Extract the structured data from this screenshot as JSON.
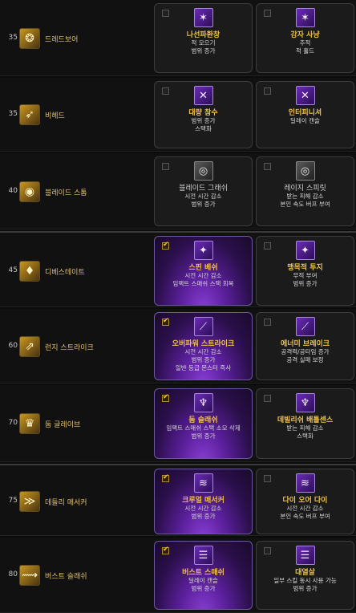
{
  "rows": [
    {
      "level": "35",
      "skill": "드레드보어",
      "left": {
        "title": "나선파환창",
        "lines": [
          "적 모으기",
          "범위 증가"
        ],
        "checked": false,
        "selected": false
      },
      "right": {
        "title": "강자 사냥",
        "lines": [
          "추적",
          "적 홀드"
        ],
        "checked": false,
        "selected": false
      }
    },
    {
      "level": "35",
      "skill": "비헤드",
      "left": {
        "title": "대량 참수",
        "lines": [
          "범위 증가",
          "스택화"
        ],
        "checked": false,
        "selected": false
      },
      "right": {
        "title": "인터피니셔",
        "lines": [
          "딜레이 캔슬"
        ],
        "checked": false,
        "selected": false
      }
    },
    {
      "level": "40",
      "skill": "블레이드 스톰",
      "left": {
        "title": "블레이드 그래쉬",
        "lines": [
          "시전 시간 감소",
          "범위 증가"
        ],
        "checked": false,
        "selected": false
      },
      "right": {
        "title": "레이지 스피릿",
        "lines": [
          "받는 피해 감소",
          "본인 속도 버프 부여"
        ],
        "checked": false,
        "selected": false
      }
    },
    {
      "level": "45",
      "skill": "디베스테이트",
      "left": {
        "title": "스핀 베쉬",
        "lines": [
          "시전 시간 감소",
          "임팩트 스매쉬 스택 회복"
        ],
        "checked": true,
        "selected": true
      },
      "right": {
        "title": "맹목적 투지",
        "lines": [
          "무적 부여",
          "범위 증가"
        ],
        "checked": false,
        "selected": false
      }
    },
    {
      "level": "60",
      "skill": "런지 스트라이크",
      "left": {
        "title": "오버파워 스트라이크",
        "lines": [
          "시전 시간 감소",
          "범위 증가",
          "일반 등급 몬스터 즉사"
        ],
        "checked": true,
        "selected": true
      },
      "right": {
        "title": "에너미 브레이크",
        "lines": [
          "공격력/공타임 증가",
          "공격 실패 보정"
        ],
        "checked": false,
        "selected": false
      }
    },
    {
      "level": "70",
      "skill": "둠 글레이브",
      "left": {
        "title": "둠 슬래쉬",
        "lines": [
          "임팩트 스매쉬 스택 소모 삭제",
          "범위 증가"
        ],
        "checked": true,
        "selected": true
      },
      "right": {
        "title": "데빌리쉬 배틀센스",
        "lines": [
          "받는 피해 감소",
          "스택화"
        ],
        "checked": false,
        "selected": false
      }
    },
    {
      "level": "75",
      "skill": "데들리 매서커",
      "left": {
        "title": "크루얼 매서커",
        "lines": [
          "시전 시간 감소",
          "범위 증가"
        ],
        "checked": true,
        "selected": true
      },
      "right": {
        "title": "다이 오어 다이",
        "lines": [
          "시전 시간 감소",
          "본인 속도 버프 부여"
        ],
        "checked": false,
        "selected": false
      }
    },
    {
      "level": "80",
      "skill": "버스트 슬래쉬",
      "left": {
        "title": "버스트 스매쉬",
        "lines": [
          "딜레이 캔슬",
          "범위 증가"
        ],
        "checked": true,
        "selected": true
      },
      "right": {
        "title": "대열살",
        "lines": [
          "일부 스킬 동시 사용 가능",
          "범위 증가"
        ],
        "checked": false,
        "selected": false
      }
    }
  ],
  "icons": {
    "skill_icon": "skill-icon",
    "tripod_icon": "tripod-icon",
    "checkbox": "checkbox"
  },
  "colors": {
    "gold": "#f0c24a",
    "selected_purple": "#6a2bb8",
    "background": "#111111"
  }
}
